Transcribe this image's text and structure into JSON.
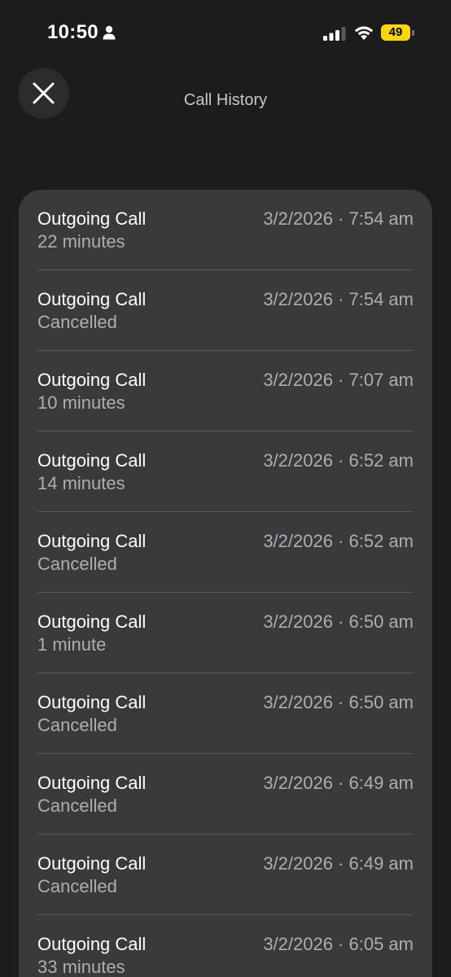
{
  "status_bar": {
    "time": "10:50",
    "battery": "49",
    "battery_color": "#ffd60a"
  },
  "header": {
    "title": "Call History",
    "close_icon": "close-icon"
  },
  "calls": [
    {
      "type": "Outgoing Call",
      "detail": "22 minutes",
      "date": "3/2/2026 · 7:54 am"
    },
    {
      "type": "Outgoing Call",
      "detail": "Cancelled",
      "date": "3/2/2026 · 7:54 am"
    },
    {
      "type": "Outgoing Call",
      "detail": "10 minutes",
      "date": "3/2/2026 · 7:07 am"
    },
    {
      "type": "Outgoing Call",
      "detail": "14 minutes",
      "date": "3/2/2026 · 6:52 am"
    },
    {
      "type": "Outgoing Call",
      "detail": "Cancelled",
      "date": "3/2/2026 · 6:52 am"
    },
    {
      "type": "Outgoing Call",
      "detail": "1 minute",
      "date": "3/2/2026 · 6:50 am"
    },
    {
      "type": "Outgoing Call",
      "detail": "Cancelled",
      "date": "3/2/2026 · 6:50 am"
    },
    {
      "type": "Outgoing Call",
      "detail": "Cancelled",
      "date": "3/2/2026 · 6:49 am"
    },
    {
      "type": "Outgoing Call",
      "detail": "Cancelled",
      "date": "3/2/2026 · 6:49 am"
    },
    {
      "type": "Outgoing Call",
      "detail": "33 minutes",
      "date": "3/2/2026 · 6:05 am"
    }
  ]
}
